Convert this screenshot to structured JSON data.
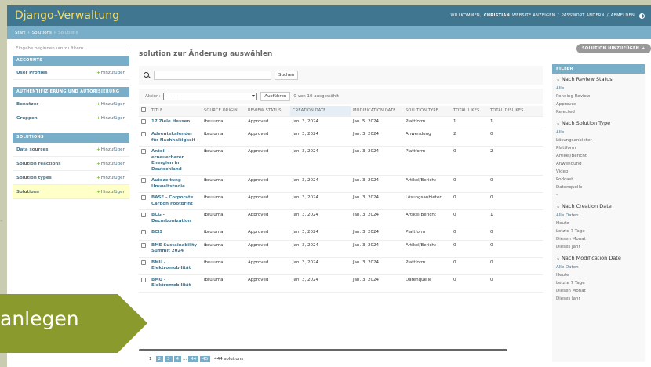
{
  "header": {
    "brand": "Django-Verwaltung",
    "welcome": "WILLKOMMEN,",
    "username": "CHRISTIAN",
    "links": [
      "WEBSITE ANZEIGEN",
      "PASSWORT ÄNDERN",
      "ABMELDEN"
    ]
  },
  "breadcrumbs": [
    "Start",
    "Solutions",
    "Solutions"
  ],
  "sidebar": {
    "filter_placeholder": "Eingabe beginnen um zu filtern...",
    "add_label": "Hinzufügen",
    "apps": [
      {
        "caption": "ACCOUNTS",
        "models": [
          "User Profiles"
        ]
      },
      {
        "caption": "AUTHENTIFIZIERUNG UND AUTORISIERUNG",
        "models": [
          "Benutzer",
          "Gruppen"
        ]
      },
      {
        "caption": "SOLUTIONS",
        "models": [
          "Data sources",
          "Solution reactions",
          "Solution types",
          "Solutions"
        ]
      }
    ]
  },
  "main": {
    "title": "solution zur Änderung auswählen",
    "add_button": "SOLUTION HINZUFÜGEN",
    "search_button": "Suchen",
    "action_label": "Aktion:",
    "action_value": "---------",
    "run_button": "Ausführen",
    "selected_count": "0 von 10 ausgewählt",
    "columns": [
      "TITLE",
      "SOURCE ORIGIN",
      "REVIEW STATUS",
      "CREATION DATE",
      "MODIFICATION DATE",
      "SOLUTION TYPE",
      "TOTAL LIKES",
      "TOTAL DISLIKES"
    ],
    "rows": [
      {
        "title": "17 Ziele Hessen",
        "origin": "ibruluma",
        "status": "Approved",
        "created": "Jan. 3, 2024",
        "modified": "Jan. 5, 2024",
        "type": "Plattform",
        "likes": "1",
        "dislikes": "1"
      },
      {
        "title": "Adventskalender für Nachhaltigkeit",
        "origin": "ibruluma",
        "status": "Approved",
        "created": "Jan. 3, 2024",
        "modified": "Jan. 3, 2024",
        "type": "Anwendung",
        "likes": "2",
        "dislikes": "0"
      },
      {
        "title": "Anteil erneuerbarer Energien in Deutschland",
        "origin": "ibruluma",
        "status": "Approved",
        "created": "Jan. 3, 2024",
        "modified": "Jan. 3, 2024",
        "type": "Plattform",
        "likes": "0",
        "dislikes": "2"
      },
      {
        "title": "Autozeitung - Umweltstudie",
        "origin": "ibruluma",
        "status": "Approved",
        "created": "Jan. 3, 2024",
        "modified": "Jan. 3, 2024",
        "type": "Artikel/Bericht",
        "likes": "0",
        "dislikes": "0"
      },
      {
        "title": "BASF - Corporate Carbon Footprint",
        "origin": "ibruluma",
        "status": "Approved",
        "created": "Jan. 3, 2024",
        "modified": "Jan. 3, 2024",
        "type": "Lösungsanbieter",
        "likes": "0",
        "dislikes": "0"
      },
      {
        "title": "BCG - Decarbonization",
        "origin": "ibruluma",
        "status": "Approved",
        "created": "Jan. 3, 2024",
        "modified": "Jan. 3, 2024",
        "type": "Artikel/Bericht",
        "likes": "0",
        "dislikes": "1"
      },
      {
        "title": "BCIS",
        "origin": "ibruluma",
        "status": "Approved",
        "created": "Jan. 3, 2024",
        "modified": "Jan. 3, 2024",
        "type": "Plattform",
        "likes": "0",
        "dislikes": "0"
      },
      {
        "title": "BME Sustainability Summit 2024",
        "origin": "ibruluma",
        "status": "Approved",
        "created": "Jan. 3, 2024",
        "modified": "Jan. 3, 2024",
        "type": "Artikel/Bericht",
        "likes": "0",
        "dislikes": "0"
      },
      {
        "title": "BMU - Elektromobilität",
        "origin": "ibruluma",
        "status": "Approved",
        "created": "Jan. 3, 2024",
        "modified": "Jan. 3, 2024",
        "type": "Plattform",
        "likes": "0",
        "dislikes": "0"
      },
      {
        "title": "BMU - Elektromobilität",
        "origin": "ibruluma",
        "status": "Approved",
        "created": "Jan. 3, 2024",
        "modified": "Jan. 3, 2024",
        "type": "Datenquelle",
        "likes": "0",
        "dislikes": "0"
      }
    ],
    "pagination": {
      "pages": [
        "1",
        "2",
        "3",
        "4",
        "44",
        "45"
      ],
      "ellipsis": "...",
      "count": "444 solutions"
    }
  },
  "filter": {
    "caption": "FILTER",
    "groups": [
      {
        "heading": "Nach Review Status",
        "options": [
          "Alle",
          "Pending Review",
          "Approved",
          "Rejected"
        ]
      },
      {
        "heading": "Nach Solution Type",
        "options": [
          "Alle",
          "Lösungsanbieter",
          "Plattform",
          "Artikel/Bericht",
          "Anwendung",
          "Video",
          "Podcast",
          "Datenquelle",
          "-"
        ]
      },
      {
        "heading": "Nach Creation Date",
        "options": [
          "Alle Daten",
          "Heute",
          "Letzte 7 Tage",
          "Diesen Monat",
          "Dieses Jahr"
        ]
      },
      {
        "heading": "Nach Modification Date",
        "options": [
          "Alle Daten",
          "Heute",
          "Letzte 7 Tage",
          "Diesen Monat",
          "Dieses Jahr"
        ]
      }
    ]
  },
  "overlay": {
    "label": "anlegen"
  },
  "colors": {
    "primary": "#417690",
    "secondary": "#79aec8",
    "accent": "#f5dd5d",
    "overlay": "#8a9a2c"
  }
}
